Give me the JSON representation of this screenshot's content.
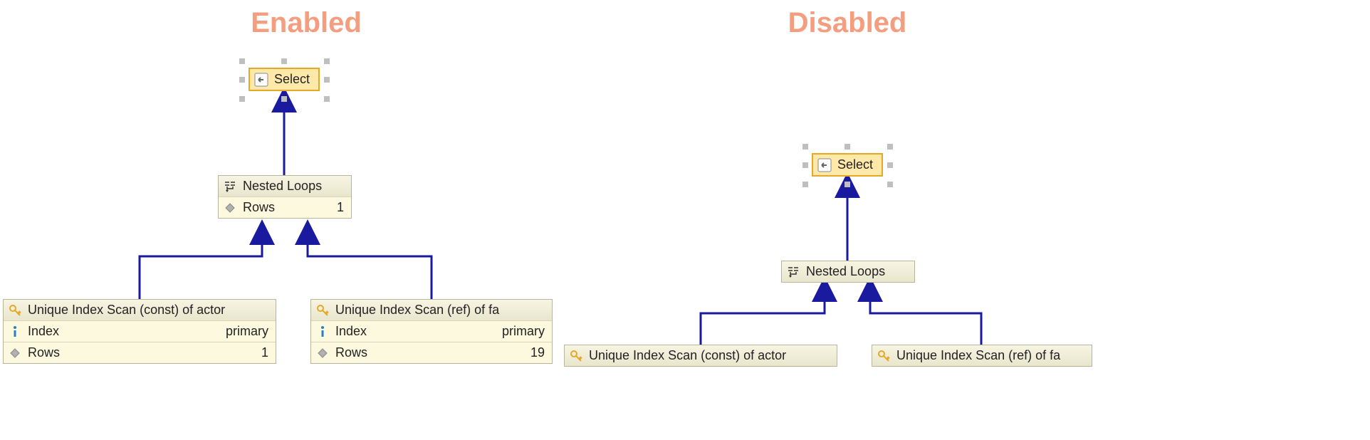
{
  "titles": {
    "enabled": "Enabled",
    "disabled": "Disabled"
  },
  "enabled": {
    "select": {
      "label": "Select"
    },
    "nestedLoops": {
      "label": "Nested Loops",
      "rows_label": "Rows",
      "rows_value": "1"
    },
    "leftScan": {
      "label": "Unique Index Scan (const) of actor",
      "index_label": "Index",
      "index_value": "primary",
      "rows_label": "Rows",
      "rows_value": "1"
    },
    "rightScan": {
      "label": "Unique Index Scan (ref) of fa",
      "index_label": "Index",
      "index_value": "primary",
      "rows_label": "Rows",
      "rows_value": "19"
    }
  },
  "disabled": {
    "select": {
      "label": "Select"
    },
    "nestedLoops": {
      "label": "Nested Loops"
    },
    "leftScan": {
      "label": "Unique Index Scan (const) of actor"
    },
    "rightScan": {
      "label": "Unique Index Scan (ref) of fa"
    }
  },
  "icons": {
    "select": "arrow-left-icon",
    "nestedLoops": "join-icon",
    "rows": "diamond-icon",
    "key": "key-icon",
    "info": "info-icon"
  },
  "colors": {
    "title": "#f59d7f",
    "arrow": "#1a1a9e",
    "selectedBorder": "#e6a826",
    "nodeBg": "#f3f0d9"
  }
}
